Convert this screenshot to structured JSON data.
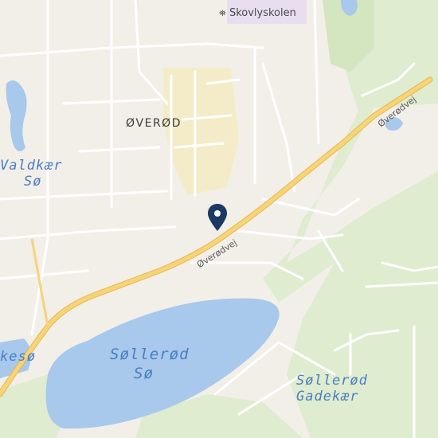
{
  "map": {
    "places": {
      "overod": "ØVERØD"
    },
    "pois": {
      "school": "Skovlyskolen"
    },
    "roads": {
      "main_1": "Øverødvej",
      "main_2": "Øverødvej"
    },
    "water": {
      "valdkaer_1": "Valdkær",
      "valdkaer_2": "Sø",
      "sollerod_so_1": "Søllerød",
      "sollerod_so_2": "Sø",
      "gadekaer_1": "Søllerød",
      "gadekaer_2": "Gadekær",
      "kesoe": "kesø"
    },
    "colors": {
      "background": "#f2efe9",
      "water": "#a8c8ec",
      "road_major": "#f6d47a",
      "road_minor": "#ffffff",
      "park": "#dfeccf",
      "residential_highlight": "#f4ecc8",
      "marker": "#1a3a63"
    },
    "marker": {
      "icon": "location-pin-icon"
    }
  }
}
